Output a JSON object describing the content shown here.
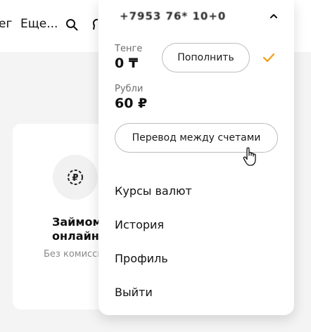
{
  "topbar": {
    "nav_partial": "ег",
    "nav_more": "Еще...",
    "search_icon": "search-icon",
    "second_icon": "user-icon-partial"
  },
  "promo_card": {
    "icon": "ruble-coin-icon",
    "title": "Займом онлайн",
    "subtitle": "Без комиссии"
  },
  "account_menu": {
    "account_name": "+7953 76* 10+0",
    "collapse_icon": "chevron-up-icon",
    "balances": [
      {
        "label": "Тенге",
        "amount": "0 ₸"
      },
      {
        "label": "Рубли",
        "amount": "60 ₽"
      }
    ],
    "topup_label": "Пополнить",
    "selected_icon": "checkmark-icon",
    "selected_color": "#f39c12",
    "transfer_label": "Перевод между счетами",
    "links": [
      "Курсы валют",
      "История",
      "Профиль",
      "Выйти"
    ]
  }
}
